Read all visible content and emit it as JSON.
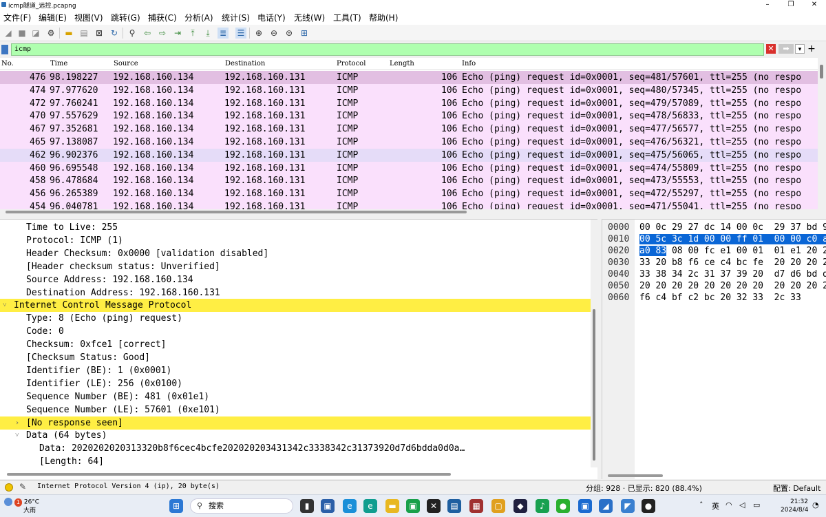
{
  "window": {
    "title": "icmp隧道_远控.pcapng",
    "controls": [
      "–",
      "❐",
      "✕"
    ]
  },
  "menu": [
    "文件(F)",
    "编辑(E)",
    "视图(V)",
    "跳转(G)",
    "捕获(C)",
    "分析(A)",
    "统计(S)",
    "电话(Y)",
    "无线(W)",
    "工具(T)",
    "帮助(H)"
  ],
  "filter": {
    "value": "icmp"
  },
  "packet_list": {
    "columns": [
      "No.",
      "Time",
      "Source",
      "Destination",
      "Protocol",
      "Length",
      "Info"
    ],
    "rows": [
      {
        "no": "476",
        "time": "98.198227",
        "src": "192.168.160.134",
        "dst": "192.168.160.131",
        "proto": "ICMP",
        "len": "106",
        "info": "Echo (ping) request  id=0x0001, seq=481/57601, ttl=255 (no respo"
      },
      {
        "no": "474",
        "time": "97.977620",
        "src": "192.168.160.134",
        "dst": "192.168.160.131",
        "proto": "ICMP",
        "len": "106",
        "info": "Echo (ping) request  id=0x0001, seq=480/57345, ttl=255 (no respo"
      },
      {
        "no": "472",
        "time": "97.760241",
        "src": "192.168.160.134",
        "dst": "192.168.160.131",
        "proto": "ICMP",
        "len": "106",
        "info": "Echo (ping) request  id=0x0001, seq=479/57089, ttl=255 (no respo"
      },
      {
        "no": "470",
        "time": "97.557629",
        "src": "192.168.160.134",
        "dst": "192.168.160.131",
        "proto": "ICMP",
        "len": "106",
        "info": "Echo (ping) request  id=0x0001, seq=478/56833, ttl=255 (no respo"
      },
      {
        "no": "467",
        "time": "97.352681",
        "src": "192.168.160.134",
        "dst": "192.168.160.131",
        "proto": "ICMP",
        "len": "106",
        "info": "Echo (ping) request  id=0x0001, seq=477/56577, ttl=255 (no respo"
      },
      {
        "no": "465",
        "time": "97.138087",
        "src": "192.168.160.134",
        "dst": "192.168.160.131",
        "proto": "ICMP",
        "len": "106",
        "info": "Echo (ping) request  id=0x0001, seq=476/56321, ttl=255 (no respo"
      },
      {
        "no": "462",
        "time": "96.902376",
        "src": "192.168.160.134",
        "dst": "192.168.160.131",
        "proto": "ICMP",
        "len": "106",
        "info": "Echo (ping) request  id=0x0001, seq=475/56065, ttl=255 (no respo"
      },
      {
        "no": "460",
        "time": "96.695548",
        "src": "192.168.160.134",
        "dst": "192.168.160.131",
        "proto": "ICMP",
        "len": "106",
        "info": "Echo (ping) request  id=0x0001, seq=474/55809, ttl=255 (no respo"
      },
      {
        "no": "458",
        "time": "96.478684",
        "src": "192.168.160.134",
        "dst": "192.168.160.131",
        "proto": "ICMP",
        "len": "106",
        "info": "Echo (ping) request  id=0x0001, seq=473/55553, ttl=255 (no respo"
      },
      {
        "no": "456",
        "time": "96.265389",
        "src": "192.168.160.134",
        "dst": "192.168.160.131",
        "proto": "ICMP",
        "len": "106",
        "info": "Echo (ping) request  id=0x0001, seq=472/55297, ttl=255 (no respo"
      },
      {
        "no": "454",
        "time": "96.040781",
        "src": "192.168.160.134",
        "dst": "192.168.160.131",
        "proto": "ICMP",
        "len": "106",
        "info": "Echo (ping) request  id=0x0001, seq=471/55041, ttl=255 (no respo"
      }
    ]
  },
  "details": [
    {
      "indent": 1,
      "text": "Time to Live: 255"
    },
    {
      "indent": 1,
      "text": "Protocol: ICMP (1)"
    },
    {
      "indent": 1,
      "text": "Header Checksum: 0x0000 [validation disabled]"
    },
    {
      "indent": 1,
      "text": "[Header checksum status: Unverified]"
    },
    {
      "indent": 1,
      "text": "Source Address: 192.168.160.134"
    },
    {
      "indent": 1,
      "text": "Destination Address: 192.168.160.131"
    },
    {
      "indent": 0,
      "text": "Internet Control Message Protocol",
      "arrow": "˅",
      "hl": true
    },
    {
      "indent": 1,
      "text": "Type: 8 (Echo (ping) request)"
    },
    {
      "indent": 1,
      "text": "Code: 0"
    },
    {
      "indent": 1,
      "text": "Checksum: 0xfce1 [correct]"
    },
    {
      "indent": 1,
      "text": "[Checksum Status: Good]"
    },
    {
      "indent": 1,
      "text": "Identifier (BE): 1 (0x0001)"
    },
    {
      "indent": 1,
      "text": "Identifier (LE): 256 (0x0100)"
    },
    {
      "indent": 1,
      "text": "Sequence Number (BE): 481 (0x01e1)"
    },
    {
      "indent": 1,
      "text": "Sequence Number (LE): 57601 (0xe101)"
    },
    {
      "indent": 1,
      "text": "[No response seen]",
      "arrow": "›",
      "hl": true
    },
    {
      "indent": 1,
      "text": "Data (64 bytes)",
      "arrow": "˅"
    },
    {
      "indent": 2,
      "text": "Data: 2020202020313320b8f6cec4bcfe202020203431342c3338342c31373920d7d6bdda0d0a…"
    },
    {
      "indent": 2,
      "text": "[Length: 64]"
    }
  ],
  "bytes": {
    "offsets": [
      "0000",
      "0010",
      "0020",
      "0030",
      "0040",
      "0050",
      "0060"
    ],
    "rows": [
      {
        "pre": "00 0c 29 27 dc 14 00 0c  29 37 bd 9",
        "sel": "",
        "post": ""
      },
      {
        "pre": "",
        "sel": "00 5c 3c 1d 00 00 ff 01  00 00 c0 a",
        "post": ""
      },
      {
        "pre": "",
        "sel": "a0 83",
        "post": " 08 00 fc e1 00 01  01 e1 20 2"
      },
      {
        "pre": "33 20 b8 f6 ce c4 bc fe  20 20 20 2",
        "sel": "",
        "post": ""
      },
      {
        "pre": "33 38 34 2c 31 37 39 20  d7 d6 bd d",
        "sel": "",
        "post": ""
      },
      {
        "pre": "20 20 20 20 20 20 20 20  20 20 20 2",
        "sel": "",
        "post": ""
      },
      {
        "pre": "f6 c4 bf c2 bc 20 32 33  2c 33",
        "sel": "",
        "post": ""
      }
    ]
  },
  "status": {
    "field_info": "Internet Protocol Version 4 (ip), 20 byte(s)",
    "packets": "分组: 928 · 已显示: 820 (88.4%)",
    "profile": "配置: Default"
  },
  "taskbar": {
    "weather_temp": "26°C",
    "weather_desc": "大雨",
    "weather_badge": "1",
    "search_placeholder": "搜索",
    "ime": "英",
    "time": "21:32",
    "date": "2024/8/4"
  },
  "colors": {
    "accent": "#0a66d6",
    "filter_ok": "#afffaf",
    "row_icmp": "#fae0fc",
    "highlight": "#ffee44"
  }
}
